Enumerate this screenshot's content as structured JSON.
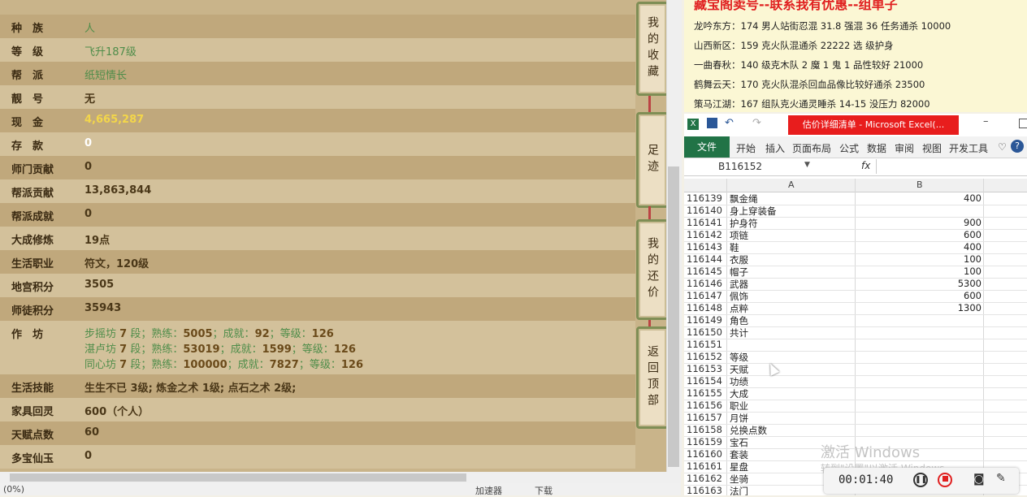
{
  "profile": {
    "rows": [
      {
        "label": "种　族",
        "value": "人",
        "style": "green"
      },
      {
        "label": "等　级",
        "value": "飞升187级",
        "style": "green"
      },
      {
        "label": "帮　派",
        "value": "纸短情长",
        "style": "green"
      },
      {
        "label": "靓　号",
        "value": "无",
        "style": "darkv"
      },
      {
        "label": "现　金",
        "value": "4,665,287",
        "style": "yellow"
      },
      {
        "label": "存　款",
        "value": "0",
        "style": "white"
      },
      {
        "label": "师门贡献",
        "value": "0",
        "style": "darkv"
      },
      {
        "label": "帮派贡献",
        "value": "13,863,844",
        "style": "darkv"
      },
      {
        "label": "帮派成就",
        "value": "0",
        "style": "darkv"
      },
      {
        "label": "大成修炼",
        "value": "19点",
        "style": "darkv"
      },
      {
        "label": "生活职业",
        "value": "符文，120级",
        "style": "darkv"
      },
      {
        "label": "地宫积分",
        "value": "3505",
        "style": "darkv"
      },
      {
        "label": "师徒积分",
        "value": "35943",
        "style": "darkv"
      }
    ],
    "workshop_label": "作　坊",
    "workshops": [
      {
        "name": "步摇坊",
        "level": "7",
        "seg": "段；熟练：",
        "skill": "5005",
        "ach_label": "；成就：",
        "ach": "92",
        "grade_label": "；等级：",
        "grade": "126"
      },
      {
        "name": "湛卢坊",
        "level": "7",
        "seg": "段；熟练：",
        "skill": "53019",
        "ach_label": "；成就：",
        "ach": "1599",
        "grade_label": "；等级：",
        "grade": "126"
      },
      {
        "name": "同心坊",
        "level": "7",
        "seg": "段；熟练：",
        "skill": "100000",
        "ach_label": "；成就：",
        "ach": "7827",
        "grade_label": "；等级：",
        "grade": "126"
      }
    ],
    "rows2": [
      {
        "label": "生活技能",
        "value": "生生不已 3级; 炼金之术 1级; 点石之术 2级;",
        "style": "darkv"
      },
      {
        "label": "家具回灵",
        "value": "600（个人）",
        "style": "darkv"
      },
      {
        "label": "天赋点数",
        "value": "60",
        "style": "darkv"
      },
      {
        "label": "多宝仙玉",
        "value": "0",
        "style": "darkv"
      }
    ],
    "side_buttons": [
      "我的收藏",
      "足迹",
      "我的还价",
      "返回顶部"
    ]
  },
  "statusbar": {
    "left": "(0%)",
    "speed": "加速器",
    "download": "下载"
  },
  "notice": {
    "header": "藏宝阁卖号--联系我有优惠--组单子",
    "lines": [
      "龙吟东方：174 男人站街忍混 31.8 强混 36 任务通杀 10000",
      "山西新区：159 克火队混通杀 22222 选 级护身",
      "一曲春秋：140 级克木队 2 魔 1 鬼 1  品性较好 21000",
      "鹤舞云天：170 克火队混杀回血品像比较好通杀 23500",
      "策马江湖：167 组队克火通灵睡杀 14-15 没压力 82000"
    ]
  },
  "excel": {
    "title": "估价详细清单 - Microsoft Excel(...",
    "file_tab": "文件",
    "menus": [
      "开始",
      "插入",
      "页面布局",
      "公式",
      "数据",
      "审阅",
      "视图",
      "开发工具"
    ],
    "name_box": "B116152",
    "fx": "fx",
    "col_a": "A",
    "col_b": "B",
    "rows": [
      {
        "n": "116139",
        "a": "飘金绳",
        "b": "400"
      },
      {
        "n": "116140",
        "a": "身上穿装备",
        "b": ""
      },
      {
        "n": "116141",
        "a": "护身符",
        "b": "900"
      },
      {
        "n": "116142",
        "a": "项链",
        "b": "600"
      },
      {
        "n": "116143",
        "a": "鞋",
        "b": "400"
      },
      {
        "n": "116144",
        "a": "衣服",
        "b": "100"
      },
      {
        "n": "116145",
        "a": "帽子",
        "b": "100"
      },
      {
        "n": "116146",
        "a": "武器",
        "b": "5300"
      },
      {
        "n": "116147",
        "a": "佩饰",
        "b": "600"
      },
      {
        "n": "116148",
        "a": "点粹",
        "b": "1300"
      },
      {
        "n": "116149",
        "a": "角色",
        "b": ""
      },
      {
        "n": "116150",
        "a": "共计",
        "b": ""
      },
      {
        "n": "116151",
        "a": "",
        "b": ""
      },
      {
        "n": "116152",
        "a": "等级",
        "b": ""
      },
      {
        "n": "116153",
        "a": "天赋",
        "b": ""
      },
      {
        "n": "116154",
        "a": "功绩",
        "b": ""
      },
      {
        "n": "116155",
        "a": "大成",
        "b": ""
      },
      {
        "n": "116156",
        "a": "职业",
        "b": ""
      },
      {
        "n": "116157",
        "a": "月饼",
        "b": ""
      },
      {
        "n": "116158",
        "a": "兑换点数",
        "b": ""
      },
      {
        "n": "116159",
        "a": "宝石",
        "b": ""
      },
      {
        "n": "116160",
        "a": "套装",
        "b": ""
      },
      {
        "n": "116161",
        "a": "星盘",
        "b": ""
      },
      {
        "n": "116162",
        "a": "坐骑",
        "b": ""
      },
      {
        "n": "116163",
        "a": "法门",
        "b": ""
      }
    ]
  },
  "watermark": {
    "line1": "激活 Windows",
    "line2": "转到\"设置\"以激活 Windows。"
  },
  "recorder": {
    "time": "00:01:40"
  }
}
